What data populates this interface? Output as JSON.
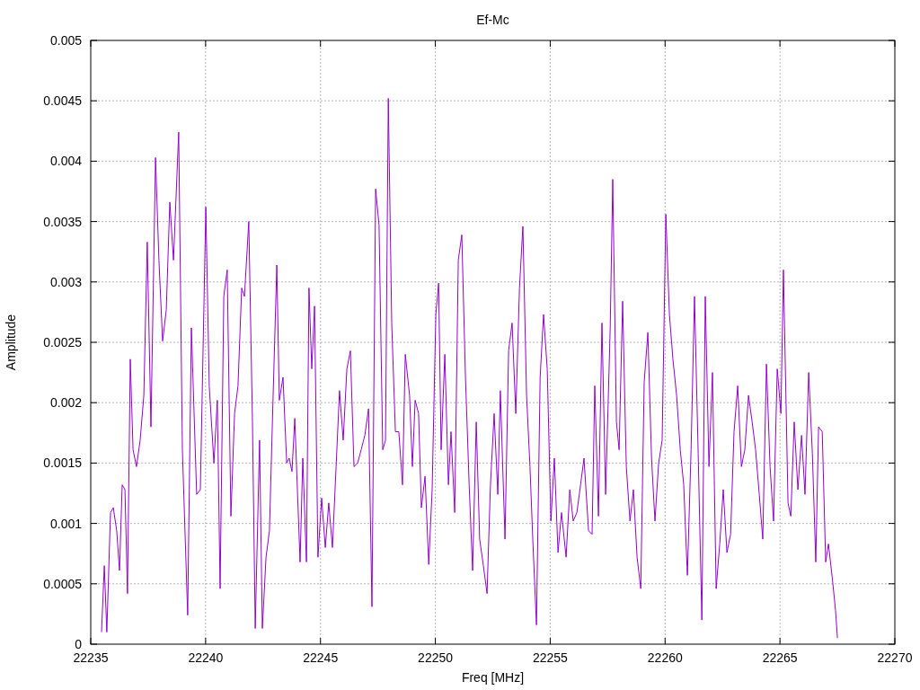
{
  "chart_data": {
    "type": "line",
    "grid": true,
    "title": "Ef-Mc",
    "xlabel": "Freq [MHz]",
    "ylabel": "Amplitude",
    "xlim": [
      22235,
      22270
    ],
    "ylim": [
      0,
      0.005
    ],
    "xticks": [
      22235,
      22240,
      22245,
      22250,
      22255,
      22260,
      22265,
      22270
    ],
    "yticks": [
      0,
      0.0005,
      0.001,
      0.0015,
      0.002,
      0.0025,
      0.003,
      0.0035,
      0.004,
      0.0045,
      0.005
    ],
    "x": [
      22235.47,
      22235.59,
      22235.7,
      22235.86,
      22235.98,
      22236.13,
      22236.25,
      22236.37,
      22236.49,
      22236.6,
      22236.72,
      22236.84,
      22236.99,
      22237.15,
      22237.31,
      22237.46,
      22237.62,
      22237.82,
      22237.97,
      22238.13,
      22238.29,
      22238.44,
      22238.6,
      22238.83,
      22238.99,
      22239.22,
      22239.38,
      22239.61,
      22239.77,
      22240.01,
      22240.16,
      22240.36,
      22240.51,
      22240.63,
      22240.79,
      22240.94,
      22241.1,
      22241.26,
      22241.41,
      22241.57,
      22241.69,
      22241.88,
      22242.04,
      22242.16,
      22242.35,
      22242.47,
      22242.63,
      22242.78,
      22242.94,
      22243.1,
      22243.21,
      22243.37,
      22243.53,
      22243.64,
      22243.76,
      22243.88,
      22244.11,
      22244.23,
      22244.39,
      22244.5,
      22244.62,
      22244.74,
      22244.89,
      22245.05,
      22245.21,
      22245.36,
      22245.52,
      22245.68,
      22245.83,
      22245.99,
      22246.15,
      22246.3,
      22246.46,
      22246.62,
      22246.77,
      22246.93,
      22247.09,
      22247.24,
      22247.4,
      22247.55,
      22247.71,
      22247.83,
      22247.95,
      22248.1,
      22248.26,
      22248.41,
      22248.57,
      22248.69,
      22248.88,
      22249.0,
      22249.12,
      22249.27,
      22249.39,
      22249.55,
      22249.71,
      22249.86,
      22250.02,
      22250.14,
      22250.25,
      22250.41,
      22250.57,
      22250.68,
      22250.84,
      22251.0,
      22251.15,
      22251.31,
      22251.47,
      22251.62,
      22251.78,
      22251.93,
      22252.09,
      22252.25,
      22252.4,
      22252.56,
      22252.72,
      22252.83,
      22253.03,
      22253.19,
      22253.34,
      22253.5,
      22253.66,
      22253.81,
      22253.97,
      22254.12,
      22254.24,
      22254.4,
      22254.56,
      22254.71,
      22254.87,
      22255.03,
      22255.18,
      22255.34,
      22255.49,
      22255.69,
      22255.85,
      22256.0,
      22256.16,
      22256.32,
      22256.47,
      22256.67,
      22256.82,
      22256.94,
      22257.1,
      22257.25,
      22257.41,
      22257.61,
      22257.72,
      22257.88,
      22258.0,
      22258.15,
      22258.31,
      22258.47,
      22258.62,
      22258.78,
      22258.94,
      22259.09,
      22259.25,
      22259.41,
      22259.56,
      22259.72,
      22259.87,
      22260.03,
      22260.19,
      22260.34,
      22260.5,
      22260.66,
      22260.81,
      22260.97,
      22261.13,
      22261.28,
      22261.44,
      22261.6,
      22261.75,
      22261.91,
      22262.06,
      22262.22,
      22262.38,
      22262.53,
      22262.69,
      22262.85,
      22263.0,
      22263.16,
      22263.32,
      22263.47,
      22263.63,
      22263.79,
      22263.94,
      22264.1,
      22264.25,
      22264.41,
      22264.57,
      22264.72,
      22264.88,
      22265.04,
      22265.15,
      22265.35,
      22265.47,
      22265.62,
      22265.78,
      22265.94,
      22266.09,
      22266.25,
      22266.41,
      22266.56,
      22266.68,
      22266.84,
      22266.99,
      22267.11,
      22267.27,
      22267.42,
      22267.5
    ],
    "series": [
      {
        "color": "#9400d3",
        "values": [
          0.0001,
          0.00065,
          0.0001,
          0.00109,
          0.00113,
          0.00094,
          0.00061,
          0.00132,
          0.00128,
          0.00042,
          0.00236,
          0.00161,
          0.00147,
          0.00169,
          0.00206,
          0.00333,
          0.0018,
          0.00403,
          0.00318,
          0.00251,
          0.00277,
          0.00366,
          0.00318,
          0.00424,
          0.00161,
          0.00024,
          0.00262,
          0.00124,
          0.00128,
          0.00362,
          0.00214,
          0.0015,
          0.00202,
          0.00046,
          0.00288,
          0.0031,
          0.00106,
          0.00191,
          0.00214,
          0.00295,
          0.00288,
          0.0035,
          0.00184,
          0.00013,
          0.00169,
          0.00013,
          0.00072,
          0.00094,
          0.00206,
          0.00314,
          0.00202,
          0.00221,
          0.0015,
          0.00154,
          0.00143,
          0.00187,
          0.00068,
          0.00154,
          0.00068,
          0.00295,
          0.00228,
          0.0028,
          0.00072,
          0.00121,
          0.0008,
          0.00117,
          0.0008,
          0.00147,
          0.0021,
          0.00169,
          0.00228,
          0.00243,
          0.00147,
          0.0015,
          0.00161,
          0.00173,
          0.00195,
          0.00031,
          0.00377,
          0.00347,
          0.00161,
          0.00169,
          0.00452,
          0.00266,
          0.00176,
          0.00176,
          0.00132,
          0.0024,
          0.00206,
          0.00147,
          0.00202,
          0.00191,
          0.00113,
          0.00139,
          0.00066,
          0.00128,
          0.00273,
          0.00299,
          0.00161,
          0.0024,
          0.00132,
          0.00176,
          0.00109,
          0.00318,
          0.00339,
          0.00221,
          0.00132,
          0.00061,
          0.00184,
          0.00087,
          0.00065,
          0.00042,
          0.00132,
          0.00191,
          0.00124,
          0.0021,
          0.00087,
          0.00243,
          0.00266,
          0.00191,
          0.00295,
          0.00346,
          0.00206,
          0.00147,
          0.00087,
          0.00016,
          0.00221,
          0.00273,
          0.00228,
          0.00102,
          0.00154,
          0.00076,
          0.00109,
          0.00072,
          0.00128,
          0.00102,
          0.00109,
          0.00132,
          0.00154,
          0.00094,
          0.00091,
          0.00214,
          0.00106,
          0.00266,
          0.00124,
          0.00262,
          0.00385,
          0.00184,
          0.00161,
          0.00284,
          0.00147,
          0.00102,
          0.00128,
          0.00072,
          0.00046,
          0.00217,
          0.00258,
          0.00154,
          0.00102,
          0.0015,
          0.00169,
          0.00356,
          0.00273,
          0.00236,
          0.00206,
          0.00161,
          0.00132,
          0.00057,
          0.00161,
          0.00288,
          0.00158,
          0.0002,
          0.00288,
          0.00147,
          0.00225,
          0.00046,
          0.00083,
          0.00128,
          0.00076,
          0.00091,
          0.00176,
          0.00214,
          0.00147,
          0.00161,
          0.00206,
          0.00184,
          0.00161,
          0.00124,
          0.00087,
          0.00232,
          0.00147,
          0.00102,
          0.00228,
          0.00191,
          0.0031,
          0.00117,
          0.00106,
          0.00184,
          0.00128,
          0.00173,
          0.00124,
          0.00225,
          0.00158,
          0.00068,
          0.0018,
          0.00176,
          0.00068,
          0.00083,
          0.00056,
          0.00028,
          5e-05
        ]
      }
    ]
  }
}
